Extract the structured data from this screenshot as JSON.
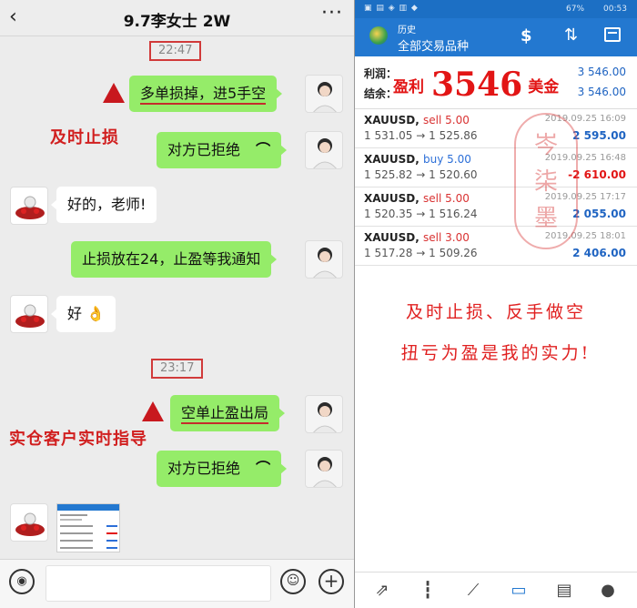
{
  "chat": {
    "title": "9.7李女士 2W",
    "back_icon": "‹",
    "more_icon": "···",
    "timestamps": [
      "22:47",
      "23:17"
    ],
    "messages": [
      {
        "side": "me",
        "text": "多单损掉，进5手空"
      },
      {
        "side": "me",
        "text": "对方已拒绝",
        "icon": "phone-hangup-icon"
      },
      {
        "side": "other",
        "text": "好的，老师!"
      },
      {
        "side": "me",
        "text": "止损放在24，止盈等我通知"
      },
      {
        "side": "other",
        "text": "好",
        "emoji": "👌"
      },
      {
        "side": "me",
        "text": "空单止盈出局"
      },
      {
        "side": "me",
        "text": "对方已拒绝",
        "icon": "phone-hangup-icon"
      },
      {
        "side": "other",
        "type": "image"
      }
    ],
    "notes": {
      "stop_loss": "及时止损",
      "live_guidance": "实仓客户实时指导"
    }
  },
  "app": {
    "status_bar": {
      "battery": "67%",
      "time": "00:53"
    },
    "title": "历史",
    "subtitle": "全部交易品种",
    "summary": {
      "profit_label": "利润：",
      "profit_value": "3 546.00",
      "balance_label": "结余：",
      "balance_value": "3 546.00"
    },
    "overlay": {
      "prefix": "盈利",
      "amount": "3546",
      "unit": "美金"
    },
    "trades": [
      {
        "symbol": "XAUUSD,",
        "side": "sell 5.00",
        "side_type": "sell",
        "prices": "1 531.05 → 1 525.86",
        "date": "2019.09.25 16:09",
        "profit": "2 595.00",
        "profit_type": "pos"
      },
      {
        "symbol": "XAUUSD,",
        "side": "buy 5.00",
        "side_type": "buy",
        "prices": "1 525.82 → 1 520.60",
        "date": "2019.09.25 16:48",
        "profit": "-2 610.00",
        "profit_type": "neg"
      },
      {
        "symbol": "XAUUSD,",
        "side": "sell 5.00",
        "side_type": "sell",
        "prices": "1 520.35 → 1 516.24",
        "date": "2019.09.25 17:17",
        "profit": "2 055.00",
        "profit_type": "pos"
      },
      {
        "symbol": "XAUUSD,",
        "side": "sell 3.00",
        "side_type": "sell",
        "prices": "1 517.28 → 1 509.26",
        "date": "2019.09.25 18:01",
        "profit": "2 406.00",
        "profit_type": "pos"
      }
    ],
    "seal_text": [
      "岑",
      "柒",
      "墨"
    ],
    "notes": {
      "line1": "及时止损、反手做空",
      "line2": "扭亏为盈是我的实力!"
    },
    "nav_icons": [
      "quotes-icon",
      "chart-icon",
      "trade-icon",
      "history-icon",
      "news-icon",
      "chat-icon"
    ],
    "colors": {
      "brand": "#2378d0",
      "profit": "#1f64c2",
      "loss": "#e21515",
      "sell": "#d93232",
      "buy": "#2c6fd8"
    }
  }
}
